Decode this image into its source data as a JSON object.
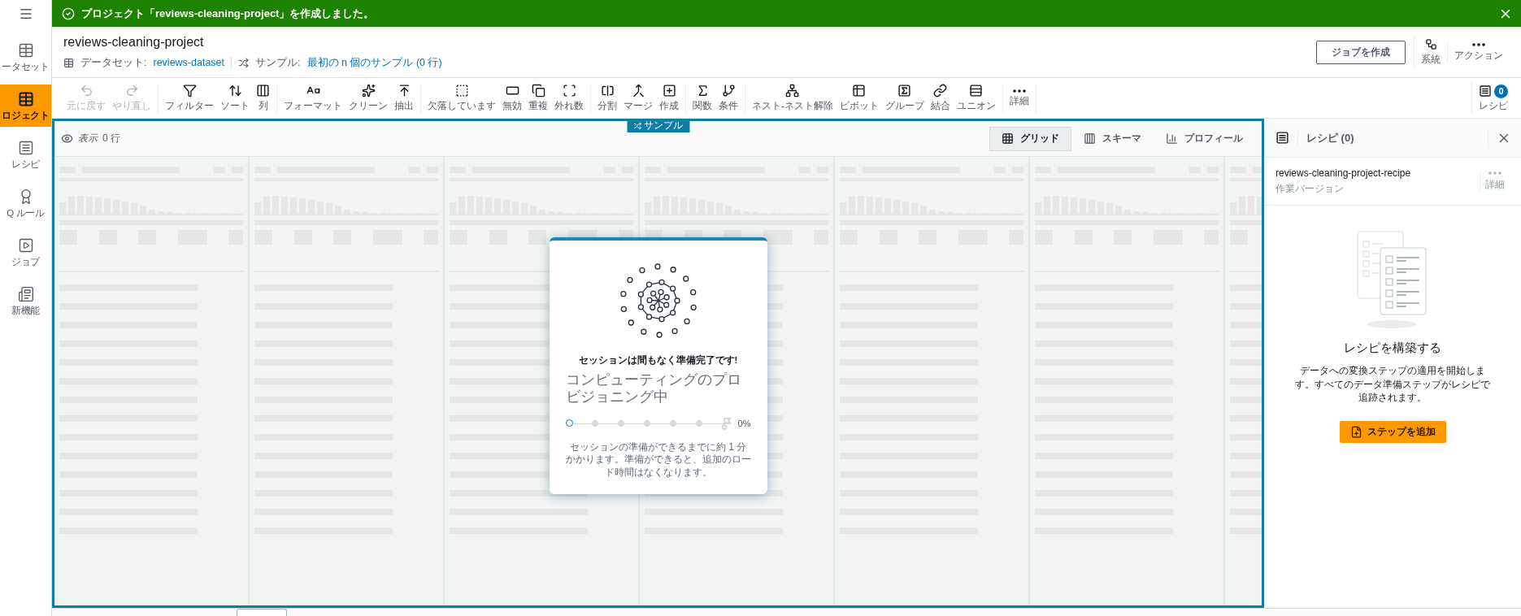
{
  "banner": {
    "message": "プロジェクト「reviews-cleaning-project」を作成しました。"
  },
  "sidebar": {
    "items": [
      {
        "label": "ータセット",
        "selected": false
      },
      {
        "label": "ロジェクト",
        "selected": true
      },
      {
        "label": "レシピ",
        "selected": false
      },
      {
        "label": "Q ルール",
        "selected": false
      },
      {
        "label": "ジョブ",
        "selected": false
      },
      {
        "label": "新機能",
        "selected": false
      }
    ]
  },
  "header": {
    "title": "reviews-cleaning-project",
    "dataset_label": "データセット:",
    "dataset_link": "reviews-dataset",
    "sample_label": "サンプル:",
    "sample_link": "最初の n 個のサンプル (0 行)",
    "create_job": "ジョブを作成",
    "actions": [
      {
        "label": "系統"
      },
      {
        "label": "アクション"
      }
    ]
  },
  "toolbar": {
    "groups": [
      [
        {
          "label": "元に戻す",
          "disabled": true
        },
        {
          "label": "やり直し",
          "disabled": true
        }
      ],
      [
        {
          "label": "フィルター",
          "disabled": false
        },
        {
          "label": "ソート",
          "disabled": false
        },
        {
          "label": "列",
          "disabled": false
        }
      ],
      [
        {
          "label": "フォーマット",
          "disabled": false
        },
        {
          "label": "クリーン",
          "disabled": false
        },
        {
          "label": "抽出",
          "disabled": false
        }
      ],
      [
        {
          "label": "欠落しています",
          "disabled": false
        },
        {
          "label": "無効",
          "disabled": false
        },
        {
          "label": "重複",
          "disabled": false
        },
        {
          "label": "外れ数",
          "disabled": false
        }
      ],
      [
        {
          "label": "分割",
          "disabled": false
        },
        {
          "label": "マージ",
          "disabled": false
        },
        {
          "label": "作成",
          "disabled": false
        }
      ],
      [
        {
          "label": "関数",
          "disabled": false
        },
        {
          "label": "条件",
          "disabled": false
        }
      ],
      [
        {
          "label": "ネスト-ネスト解除",
          "disabled": false
        },
        {
          "label": "ピボット",
          "disabled": false
        },
        {
          "label": "グループ",
          "disabled": false
        },
        {
          "label": "結合",
          "disabled": false
        },
        {
          "label": "ユニオン",
          "disabled": false
        }
      ],
      [
        {
          "label": "詳細",
          "disabled": false
        }
      ]
    ],
    "recipe": {
      "label": "レシピ",
      "count": "0"
    }
  },
  "grid": {
    "sample_tag": "サンプル",
    "view_label": "表示",
    "row_count": "0 行",
    "views": [
      {
        "label": "グリッド",
        "selected": true
      },
      {
        "label": "スキーマ",
        "selected": false
      },
      {
        "label": "プロフィール",
        "selected": false
      }
    ]
  },
  "session": {
    "heading": "セッションは間もなく準備完了です!",
    "title": "コンピューティングのプロビジョニング中",
    "level": 0,
    "percent": "0%",
    "note": "セッションの準備ができるまでに約 1 分かかります。準備ができると、追加のロード時間はなくなります。"
  },
  "recipe_panel": {
    "title": "レシピ (0)",
    "recipe_name": "reviews-cleaning-project-recipe",
    "version": "作業バージョン",
    "more_label": "詳細",
    "empty_title": "レシピを構築する",
    "empty_text": "データへの変換ステップの適用を開始します。すべてのデータ準備ステップがレシピで追跡されます。",
    "add_step": "ステップを追加"
  }
}
